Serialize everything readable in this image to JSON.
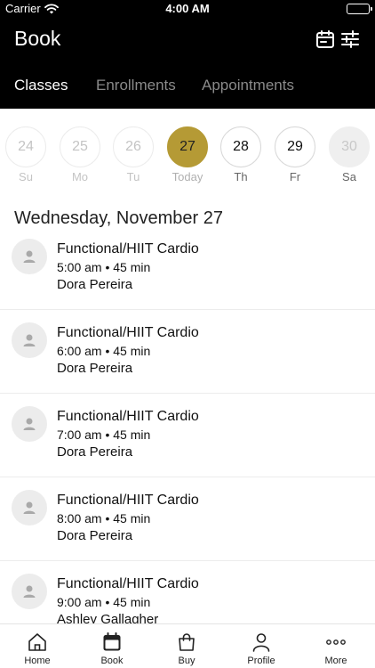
{
  "status_bar": {
    "carrier": "Carrier",
    "time": "4:00 AM",
    "battery_level": 1.0
  },
  "header": {
    "title": "Book",
    "tabs": [
      {
        "label": "Classes",
        "active": true
      },
      {
        "label": "Enrollments",
        "active": false
      },
      {
        "label": "Appointments",
        "active": false
      }
    ],
    "accent_color": "#b59a35",
    "icons": {
      "calendar": "calendar-icon",
      "filter": "sliders-icon"
    }
  },
  "date_strip": {
    "days": [
      {
        "num": "24",
        "label": "Su",
        "state": "past"
      },
      {
        "num": "25",
        "label": "Mo",
        "state": "past"
      },
      {
        "num": "26",
        "label": "Tu",
        "state": "past"
      },
      {
        "num": "27",
        "label": "Today",
        "state": "selected"
      },
      {
        "num": "28",
        "label": "Th",
        "state": "available"
      },
      {
        "num": "29",
        "label": "Fr",
        "state": "available"
      },
      {
        "num": "30",
        "label": "Sa",
        "state": "disabled"
      }
    ]
  },
  "date_heading": "Wednesday, November 27",
  "classes": [
    {
      "name": "Functional/HIIT Cardio",
      "time": "5:00 am • 45 min",
      "instructor": "Dora Pereira"
    },
    {
      "name": "Functional/HIIT Cardio",
      "time": "6:00 am • 45 min",
      "instructor": "Dora Pereira"
    },
    {
      "name": "Functional/HIIT Cardio",
      "time": "7:00 am • 45 min",
      "instructor": "Dora Pereira"
    },
    {
      "name": "Functional/HIIT Cardio",
      "time": "8:00 am • 45 min",
      "instructor": "Dora Pereira"
    },
    {
      "name": "Functional/HIIT Cardio",
      "time": "9:00 am • 45 min",
      "instructor": "Ashley Gallagher"
    }
  ],
  "tab_bar": {
    "items": [
      {
        "label": "Home",
        "icon": "home-icon"
      },
      {
        "label": "Book",
        "icon": "calendar-icon",
        "active": true
      },
      {
        "label": "Buy",
        "icon": "shopping-bag-icon"
      },
      {
        "label": "Profile",
        "icon": "person-icon"
      },
      {
        "label": "More",
        "icon": "more-icon"
      }
    ]
  }
}
